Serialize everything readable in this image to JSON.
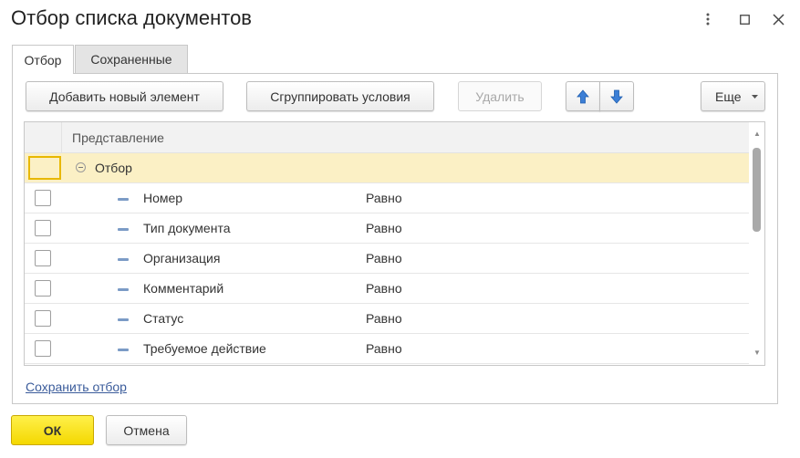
{
  "window": {
    "title": "Отбор списка документов"
  },
  "tabs": [
    {
      "label": "Отбор",
      "active": true
    },
    {
      "label": "Сохраненные",
      "active": false
    }
  ],
  "toolbar": {
    "add_label": "Добавить новый элемент",
    "group_label": "Сгруппировать условия",
    "delete_label": "Удалить",
    "more_label": "Еще"
  },
  "grid": {
    "column_header": "Представление",
    "group_row": {
      "label": "Отбор"
    },
    "rows": [
      {
        "field": "Номер",
        "comparison": "Равно"
      },
      {
        "field": "Тип документа",
        "comparison": "Равно"
      },
      {
        "field": "Организация",
        "comparison": "Равно"
      },
      {
        "field": "Комментарий",
        "comparison": "Равно"
      },
      {
        "field": "Статус",
        "comparison": "Равно"
      },
      {
        "field": "Требуемое действие",
        "comparison": "Равно"
      }
    ]
  },
  "links": {
    "save_filter": "Сохранить отбор"
  },
  "footer": {
    "ok_label": "ОК",
    "cancel_label": "Отмена"
  },
  "colors": {
    "accent_yellow": "#f4d800",
    "selected_row": "#fbf0c5",
    "arrow_blue": "#3c7fd6",
    "link": "#3b5c9b"
  },
  "icons": {
    "move_up": "arrow-up-icon",
    "move_down": "arrow-down-icon",
    "more_dropdown": "chevron-down-icon",
    "window_menu": "more-vertical-icon",
    "maximize": "maximize-icon",
    "close": "close-icon",
    "group_expander": "collapse-circle-icon",
    "filter_item": "filter-item-icon"
  }
}
